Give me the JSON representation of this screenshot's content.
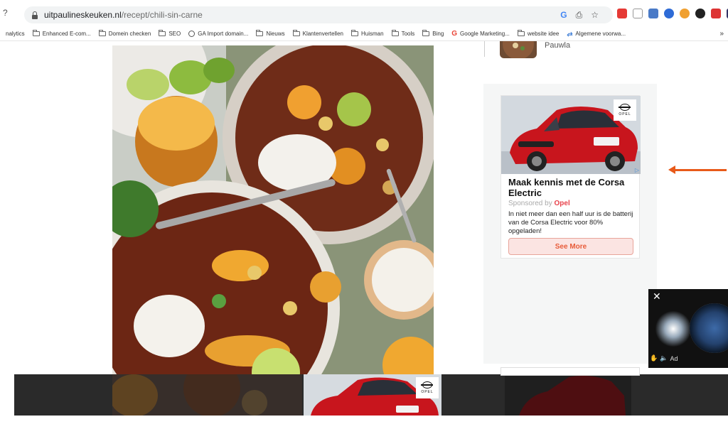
{
  "browser": {
    "left_glyph": "?",
    "url_domain": "uitpaulineskeuken.nl",
    "url_path": "/recept/chili-sin-carne",
    "address_icons": [
      "G",
      "⎙",
      "☆"
    ]
  },
  "bookmarks": [
    {
      "label": "nalytics",
      "icon": "none"
    },
    {
      "label": "Enhanced E-com...",
      "icon": "folder"
    },
    {
      "label": "Domein checken",
      "icon": "folder"
    },
    {
      "label": "SEO",
      "icon": "folder"
    },
    {
      "label": "GA Import domain...",
      "icon": "globe"
    },
    {
      "label": "Nieuws",
      "icon": "folder"
    },
    {
      "label": "Klantenvertellen",
      "icon": "folder"
    },
    {
      "label": "Huisman",
      "icon": "folder"
    },
    {
      "label": "Tools",
      "icon": "folder"
    },
    {
      "label": "Bing",
      "icon": "folder"
    },
    {
      "label": "Google Marketing...",
      "icon": "google"
    },
    {
      "label": "website idee",
      "icon": "folder"
    },
    {
      "label": "Algemene voorwa...",
      "icon": "link"
    }
  ],
  "bookmarks_more": "»",
  "sidebar_snippet": "Pauwla",
  "ad": {
    "brand_logo_text": "OPEL",
    "title": "Maak kennis met de Corsa Electric",
    "sponsored_prefix": "Sponsored by",
    "sponsor": "Opel",
    "body": "In niet meer dan een half uur is de batterij van de Corsa Electric voor 80% opgeladen!",
    "cta": "See More",
    "adchoices": "▷"
  },
  "video": {
    "close": "✕",
    "ad_label": "Ad"
  },
  "colors": {
    "accent_orange": "#e85a1a",
    "opel_red": "#e8434c",
    "car_red": "#c8151d"
  }
}
